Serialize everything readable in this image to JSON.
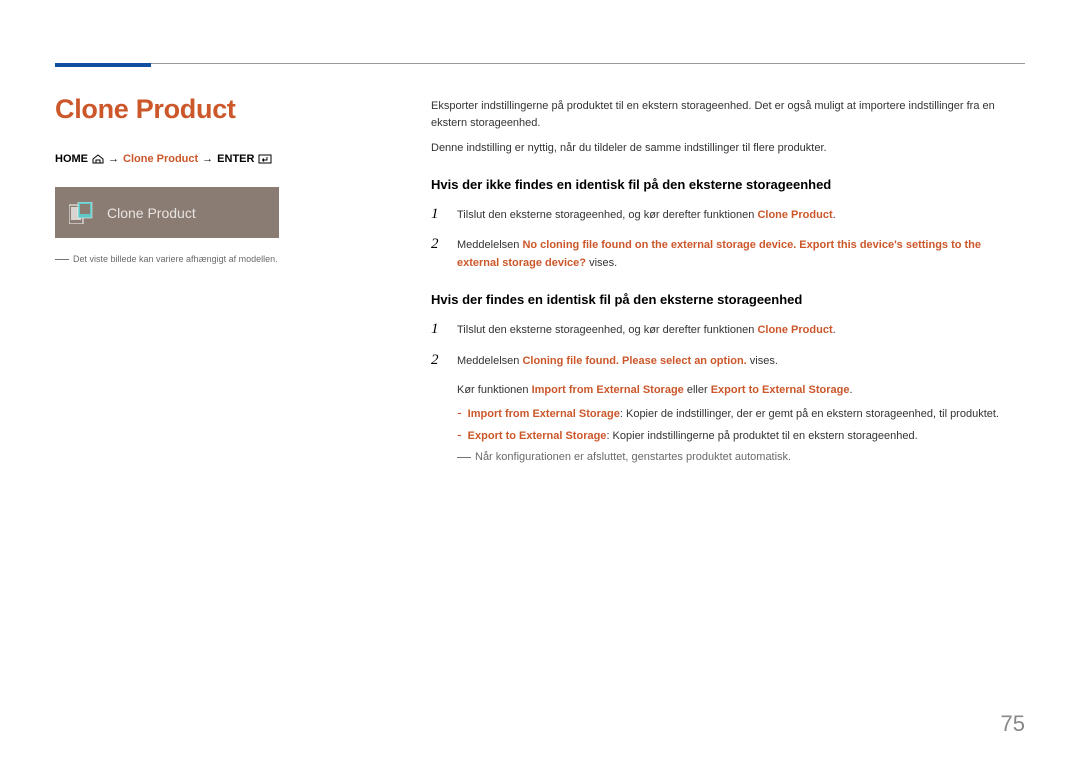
{
  "title": "Clone Product",
  "breadcrumb": {
    "home": "HOME",
    "middle": "Clone Product",
    "enter": "ENTER"
  },
  "tile_label": "Clone Product",
  "left_footnote": "Det viste billede kan variere afhængigt af modellen.",
  "intro1": "Eksporter indstillingerne på produktet til en ekstern storageenhed. Det er også muligt at importere indstillinger fra en ekstern storageenhed.",
  "intro2": "Denne indstilling er nyttig, når du tildeler de samme indstillinger til flere produkter.",
  "section1": {
    "heading": "Hvis der ikke findes en identisk fil på den eksterne storageenhed",
    "step1_pre": "Tilslut den eksterne storageenhed, og kør derefter funktionen ",
    "step1_hl": "Clone Product",
    "step1_post": ".",
    "step2_pre": "Meddelelsen ",
    "step2_hl": "No cloning file found on the external storage device. Export this device's settings to the external storage device?",
    "step2_post": " vises."
  },
  "section2": {
    "heading": "Hvis der findes en identisk fil på den eksterne storageenhed",
    "step1_pre": "Tilslut den eksterne storageenhed, og kør derefter funktionen ",
    "step1_hl": "Clone Product",
    "step1_post": ".",
    "step2_pre": "Meddelelsen ",
    "step2_hl": "Cloning file found. Please select an option.",
    "step2_post": " vises.",
    "run_pre": "Kør funktionen ",
    "run_hl1": "Import from External Storage",
    "run_mid": " eller ",
    "run_hl2": "Export to External Storage",
    "run_post": ".",
    "bullet1_hl": "Import from External Storage",
    "bullet1_text": ": Kopier de indstillinger, der er gemt på en ekstern storageenhed, til produktet.",
    "bullet2_hl": "Export to External Storage",
    "bullet2_text": ": Kopier indstillingerne på produktet til en ekstern storageenhed.",
    "config_note": "Når konfigurationen er afsluttet, genstartes produktet automatisk."
  },
  "page_number": "75"
}
